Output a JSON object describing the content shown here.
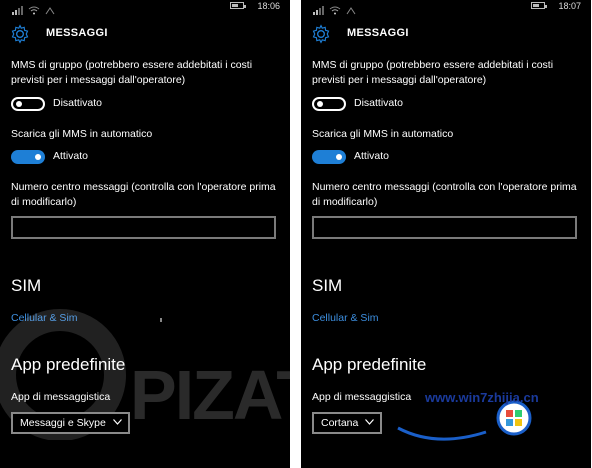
{
  "screens": [
    {
      "status_time": "18:06",
      "title": "MESSAGGI",
      "group_mms_label": "MMS di gruppo (potrebbero essere addebitati i costi previsti per i messaggi dall'operatore)",
      "group_mms_toggle_state": "Disattivato",
      "group_mms_on": false,
      "auto_mms_label": "Scarica gli MMS in automatico",
      "auto_mms_toggle_state": "Attivato",
      "auto_mms_on": true,
      "message_center_label": "Numero centro messaggi (controlla con l'operatore prima di modificarlo)",
      "message_center_value": "",
      "sim_section": "SIM",
      "sim_link": "Cellular & Sim",
      "default_apps_section": "App predefinite",
      "messaging_app_label": "App di messaggistica",
      "messaging_app_selected": "Messaggi e Skype"
    },
    {
      "status_time": "18:07",
      "title": "MESSAGGI",
      "group_mms_label": "MMS di gruppo (potrebbero essere addebitati i costi previsti per i messaggi dall'operatore)",
      "group_mms_toggle_state": "Disattivato",
      "group_mms_on": false,
      "auto_mms_label": "Scarica gli MMS in automatico",
      "auto_mms_toggle_state": "Attivato",
      "auto_mms_on": true,
      "message_center_label": "Numero centro messaggi (controlla con l'operatore prima di modificarlo)",
      "message_center_value": "",
      "sim_section": "SIM",
      "sim_link": "Cellular & Sim",
      "default_apps_section": "App predefinite",
      "messaging_app_label": "App di messaggistica",
      "messaging_app_selected": "Cortana"
    }
  ],
  "watermark": {
    "text": "PIZATO"
  },
  "site_logo": {
    "text": "www.win7zhijia.cn"
  },
  "colors": {
    "accent": "#1e7fd6",
    "link": "#3d8fe0",
    "background": "#000000",
    "text": "#ffffff"
  }
}
